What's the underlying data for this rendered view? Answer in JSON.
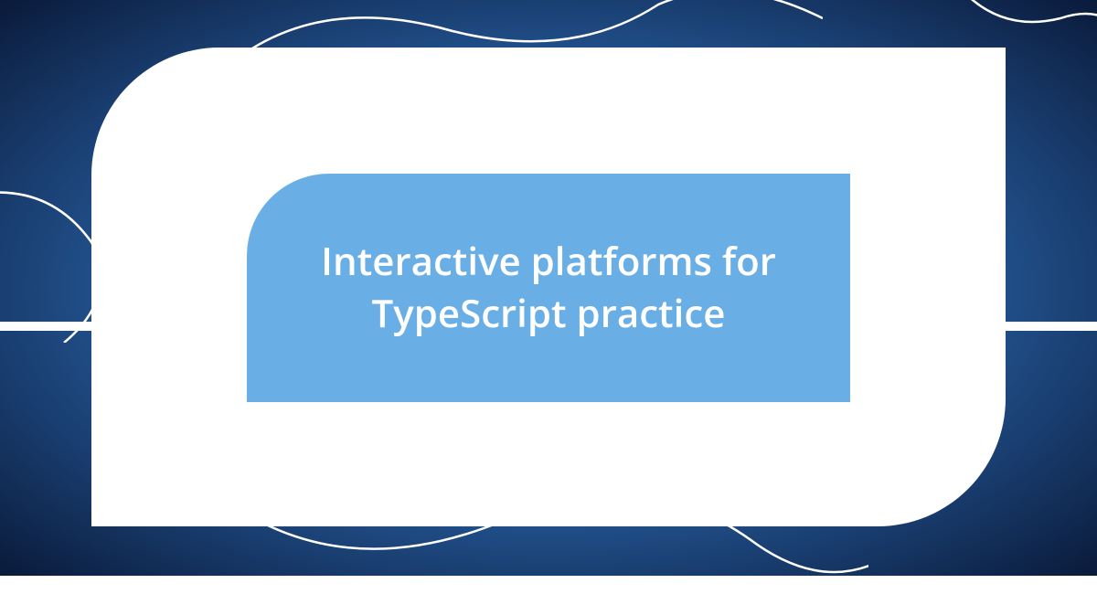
{
  "title": "Interactive platforms for TypeScript practice"
}
